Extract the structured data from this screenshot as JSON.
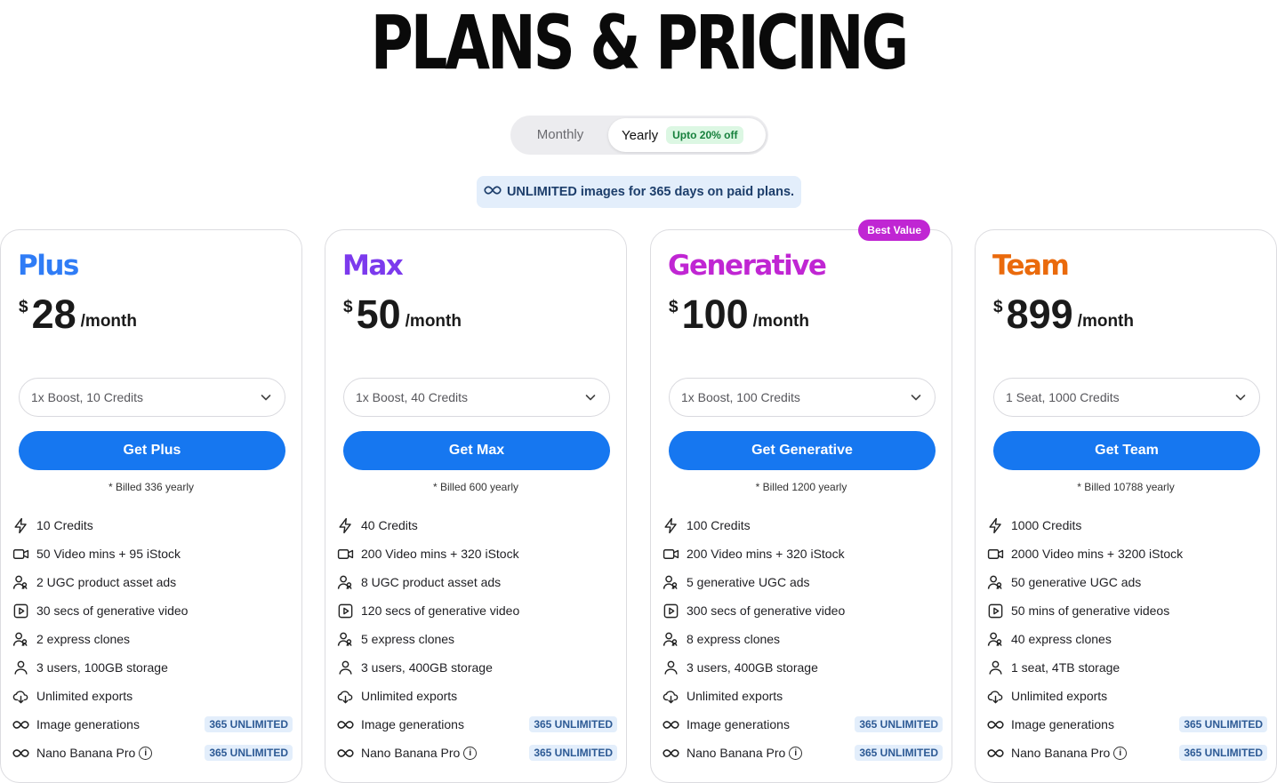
{
  "page_title": "PLANS & PRICING",
  "billing_toggle": {
    "monthly_label": "Monthly",
    "yearly_label": "Yearly",
    "yearly_discount": "Upto 20% off",
    "selected": "Yearly"
  },
  "banner": {
    "text": "UNLIMITED images for 365 days on paid plans."
  },
  "plans": [
    {
      "name": "Plus",
      "color": "#2f7cf6",
      "currency": "$",
      "price": "28",
      "period": "/month",
      "option": "1x Boost, 10 Credits",
      "cta": "Get Plus",
      "billed": "* Billed 336 yearly",
      "features": [
        "10 Credits",
        "50 Video mins + 95 iStock",
        "2 UGC product asset ads",
        "30 secs of generative video",
        "2 express clones",
        "3 users, 100GB storage",
        "Unlimited exports",
        "Image generations",
        "Nano Banana Pro"
      ]
    },
    {
      "name": "Max",
      "color": "#7c3aed",
      "currency": "$",
      "price": "50",
      "period": "/month",
      "option": "1x Boost, 40 Credits",
      "cta": "Get Max",
      "billed": "* Billed 600 yearly",
      "features": [
        "40 Credits",
        "200 Video mins + 320 iStock",
        "8 UGC product asset ads",
        "120 secs of generative video",
        "5 express clones",
        "3 users, 400GB storage",
        "Unlimited exports",
        "Image generations",
        "Nano Banana Pro"
      ]
    },
    {
      "name": "Generative",
      "color": "#c026d3",
      "currency": "$",
      "price": "100",
      "period": "/month",
      "option": "1x Boost, 100 Credits",
      "cta": "Get Generative",
      "billed": "* Billed 1200 yearly",
      "badge": "Best Value",
      "features": [
        "100 Credits",
        "200 Video mins + 320 iStock",
        "5 generative UGC ads",
        "300 secs of generative video",
        "8 express clones",
        "3 users, 400GB storage",
        "Unlimited exports",
        "Image generations",
        "Nano Banana Pro"
      ]
    },
    {
      "name": "Team",
      "color": "#ea6a0c",
      "currency": "$",
      "price": "899",
      "period": "/month",
      "option": "1 Seat, 1000 Credits",
      "cta": "Get Team",
      "billed": "* Billed 10788 yearly",
      "features": [
        "1000 Credits",
        "2000 Video mins + 3200 iStock",
        "50 generative UGC ads",
        "50 mins of generative videos",
        "40 express clones",
        "1 seat, 4TB storage",
        "Unlimited exports",
        "Image generations",
        "Nano Banana Pro"
      ]
    }
  ],
  "unlimited_tag": "365 UNLIMITED",
  "info_glyph": "i",
  "feature_icons": [
    "bolt-icon",
    "video-camera-icon",
    "users-icon",
    "play-square-icon",
    "users-icon",
    "user-icon",
    "cloud-download-icon",
    "infinity-icon",
    "infinity-icon"
  ]
}
